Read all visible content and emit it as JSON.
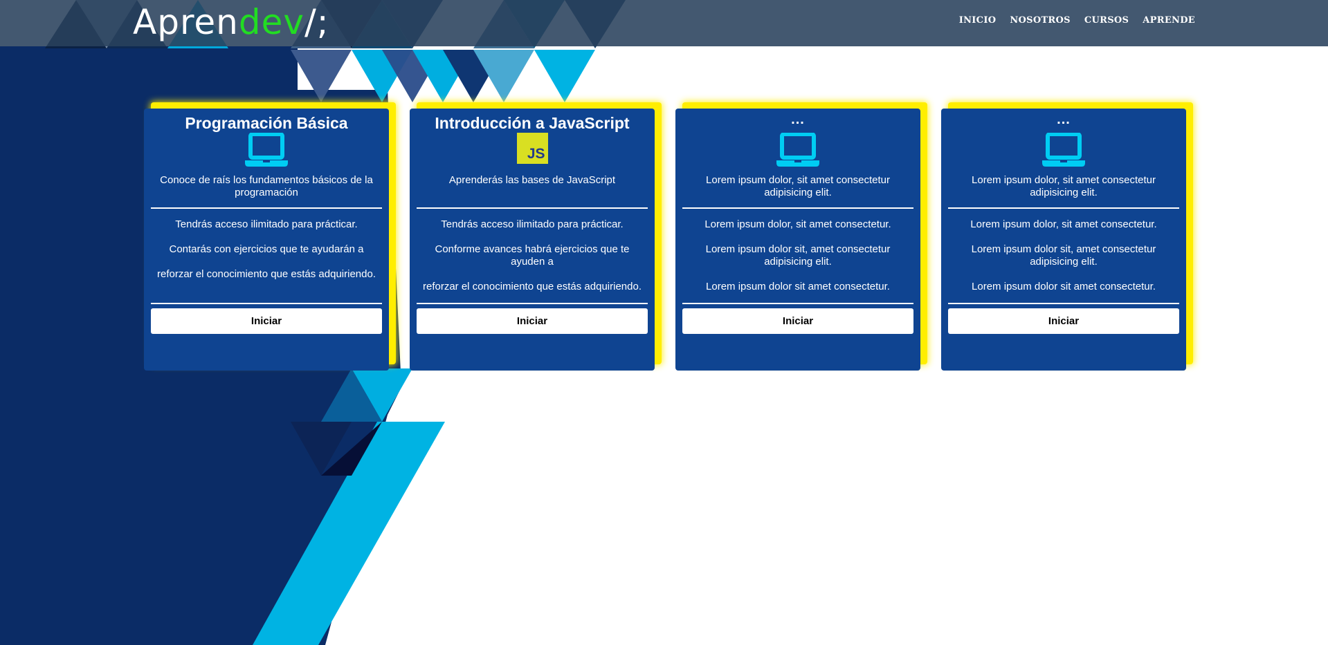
{
  "header": {
    "logo_main": "Apren",
    "logo_accent": "dev",
    "logo_suffix": "/;",
    "nav": [
      "INICIO",
      "NOSOTROS",
      "CURSOS",
      "APRENDE"
    ]
  },
  "cards": [
    {
      "title": "Programación Básica",
      "icon": "laptop-icon",
      "description": "Conoce de raís los fundamentos básicos de la programación",
      "features": [
        "Tendrás acceso ilimitado para prácticar.",
        "Contarás con ejercicios que te ayudarán a",
        "reforzar el conocimiento que estás adquiriendo."
      ],
      "button": "Iniciar"
    },
    {
      "title": "Introducción a JavaScript",
      "icon": "javascript-icon",
      "icon_text": "JS",
      "description": "Aprenderás las bases de JavaScript",
      "features": [
        "Tendrás acceso ilimitado para prácticar.",
        "Conforme avances habrá ejercicios que te ayuden a",
        "reforzar el conocimiento que estás adquiriendo."
      ],
      "button": "Iniciar"
    },
    {
      "title": "...",
      "icon": "laptop-icon",
      "description": "Lorem ipsum dolor, sit amet consectetur adipisicing elit.",
      "features": [
        "Lorem ipsum dolor, sit amet consectetur.",
        "Lorem ipsum dolor sit, amet consectetur adipisicing elit.",
        "Lorem ipsum dolor sit amet consectetur."
      ],
      "button": "Iniciar"
    },
    {
      "title": "...",
      "icon": "laptop-icon",
      "description": "Lorem ipsum dolor, sit amet consectetur adipisicing elit.",
      "features": [
        "Lorem ipsum dolor, sit amet consectetur.",
        "Lorem ipsum dolor sit, amet consectetur adipisicing elit.",
        "Lorem ipsum dolor sit amet consectetur."
      ],
      "button": "Iniciar"
    }
  ],
  "colors": {
    "navy": "#0b2c66",
    "card": "#0f4491",
    "cyan": "#00b3e3",
    "accent_green": "#22dd22",
    "glow_yellow": "#ffee00"
  }
}
